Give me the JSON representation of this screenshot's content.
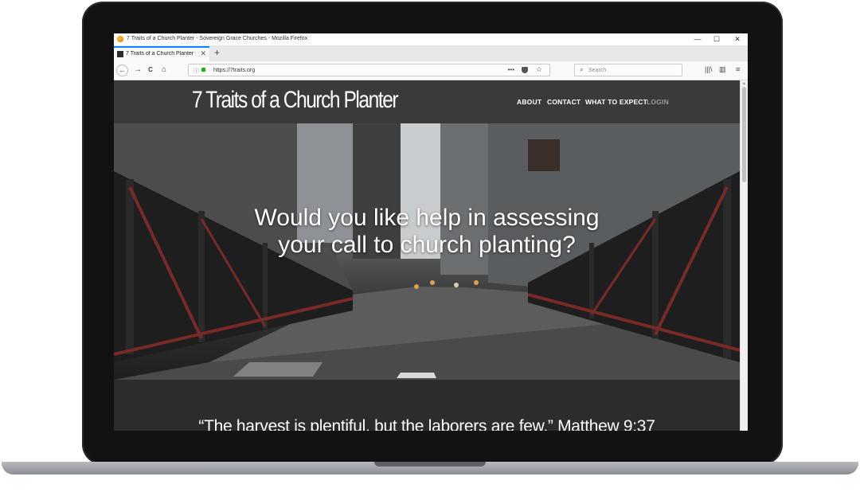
{
  "window": {
    "title": "7 Traits of a Church Planter - Sovereign Grace Churches - Mozilla Firefox",
    "controls": {
      "minimize": "—",
      "maximize": "☐",
      "close": "✕"
    }
  },
  "tabs": [
    {
      "label": "7 Traits of a Church Planter - So",
      "close": "✕"
    }
  ],
  "new_tab": "+",
  "nav": {
    "back": "←",
    "forward": "→",
    "reload": "C",
    "home": "⌂",
    "url": "https://7traits.org",
    "page_actions": "•••",
    "search_placeholder": "Search",
    "search_icon": "⌕"
  },
  "right_icons": {
    "library": "|||\\",
    "sidebar": "▥",
    "menu": "≡"
  },
  "site": {
    "brand": "7 Traits of a Church Planter",
    "menu": [
      "ABOUT",
      "CONTACT",
      "WHAT TO EXPECT",
      "LOGIN"
    ],
    "hero_heading": "Would you like help in assessing your call to church planting?",
    "quote": "“The harvest is plentiful, but the laborers are few.” Matthew 9:37"
  },
  "colors": {
    "header_bg": "#3a3a3a",
    "page_bg": "#2c2c2c",
    "login": "#9a9a9a",
    "tab_accent": "#0a84ff"
  }
}
